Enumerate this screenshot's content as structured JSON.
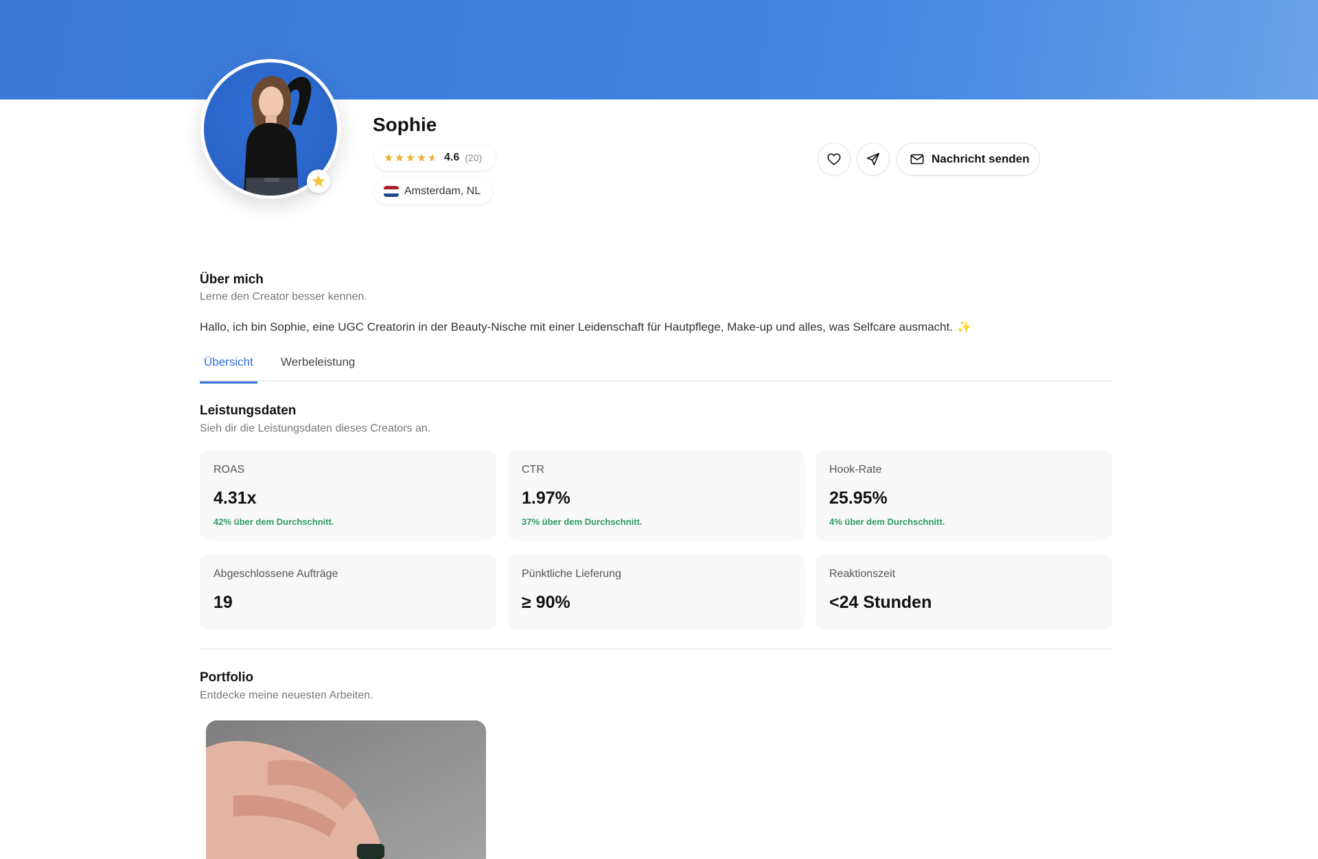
{
  "profile": {
    "name": "Sophie",
    "rating_value": "4.6",
    "rating_count": "(20)",
    "location": "Amsterdam, NL",
    "stars": 4.6
  },
  "actions": {
    "message_label": "Nachricht senden"
  },
  "about": {
    "title": "Über mich",
    "subtitle": "Lerne den Creator besser kennen.",
    "text": "Hallo, ich bin Sophie, eine UGC Creatorin in der Beauty-Nische mit einer Leidenschaft für Hautpflege, Make-up und alles, was Selfcare ausmacht.",
    "emoji": "✨"
  },
  "tabs": [
    {
      "label": "Übersicht",
      "active": true
    },
    {
      "label": "Werbeleistung",
      "active": false
    }
  ],
  "performance": {
    "title": "Leistungsdaten",
    "subtitle": "Sieh dir die Leistungsdaten dieses Creators an.",
    "cards": [
      {
        "label": "ROAS",
        "value": "4.31x",
        "note": "42% über dem Durchschnitt."
      },
      {
        "label": "CTR",
        "value": "1.97%",
        "note": "37% über dem Durchschnitt."
      },
      {
        "label": "Hook-Rate",
        "value": "25.95%",
        "note": "4% über dem Durchschnitt."
      },
      {
        "label": "Abgeschlossene Aufträge",
        "value": "19"
      },
      {
        "label": "Pünktliche Lieferung",
        "value": "≥ 90%"
      },
      {
        "label": "Reaktionszeit",
        "value": "<24 Stunden"
      }
    ]
  },
  "portfolio": {
    "title": "Portfolio",
    "subtitle": "Entdecke meine neuesten Arbeiten."
  },
  "colors": {
    "accent": "#2f6fd6",
    "positive": "#2e9b65",
    "star": "#e8b43a"
  }
}
